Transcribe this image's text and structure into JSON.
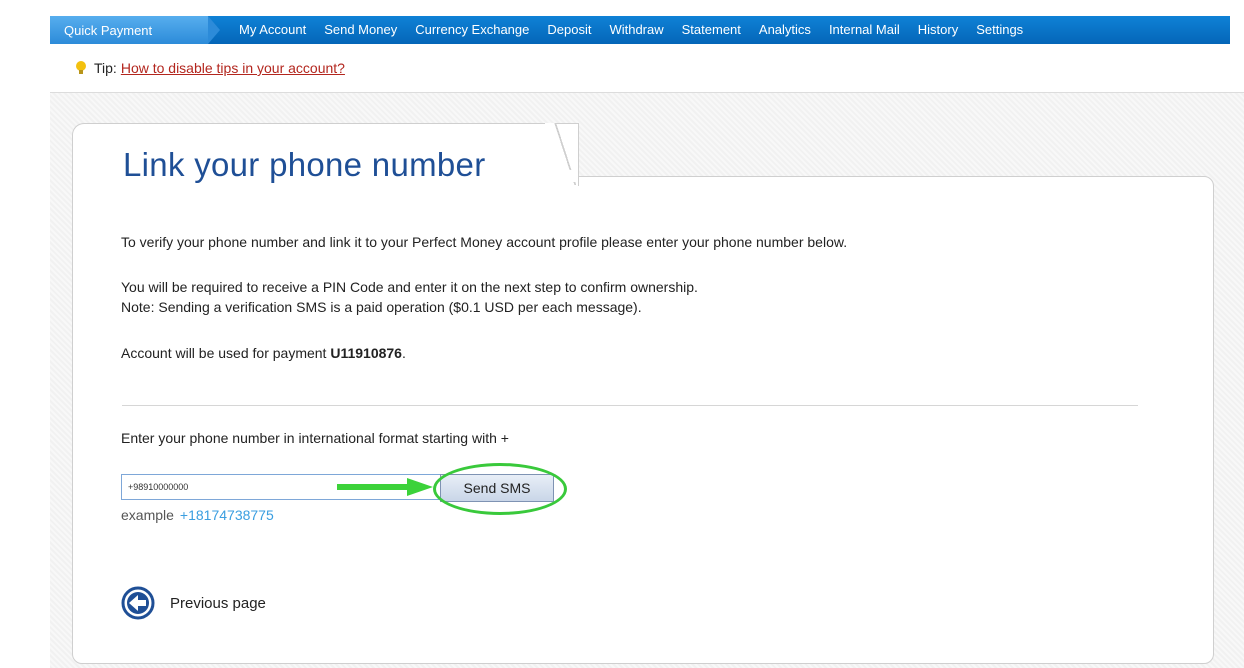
{
  "nav": {
    "active": "Quick Payment",
    "items": [
      "My Account",
      "Send Money",
      "Currency Exchange",
      "Deposit",
      "Withdraw",
      "Statement",
      "Analytics",
      "Internal Mail",
      "History",
      "Settings"
    ]
  },
  "tip": {
    "prefix": "Tip:",
    "link": "How to disable tips in your account?"
  },
  "page": {
    "title": "Link your phone number",
    "intro": "To verify your phone number and link it to your Perfect Money account profile please enter your phone number below.",
    "pin_note": "You will be required to receive a PIN Code and enter it on the next step to confirm ownership.",
    "sms_note": "Note: Sending a verification SMS is a paid operation ($0.1 USD per each message).",
    "account_prefix": "Account will be used for payment",
    "account_id": "U11910876",
    "account_suffix": ".",
    "phone_label": "Enter your phone number in international format starting with +",
    "phone_value": "+98910000000",
    "send_button": "Send SMS",
    "example_label": "example",
    "example_value": "+18174738775",
    "previous_page": "Previous page"
  },
  "colors": {
    "nav_bg": "#0466b8",
    "title": "#1f4f96",
    "highlight": "#39c93b",
    "tip_link": "#b3261e",
    "example_link": "#3a9ee0"
  }
}
